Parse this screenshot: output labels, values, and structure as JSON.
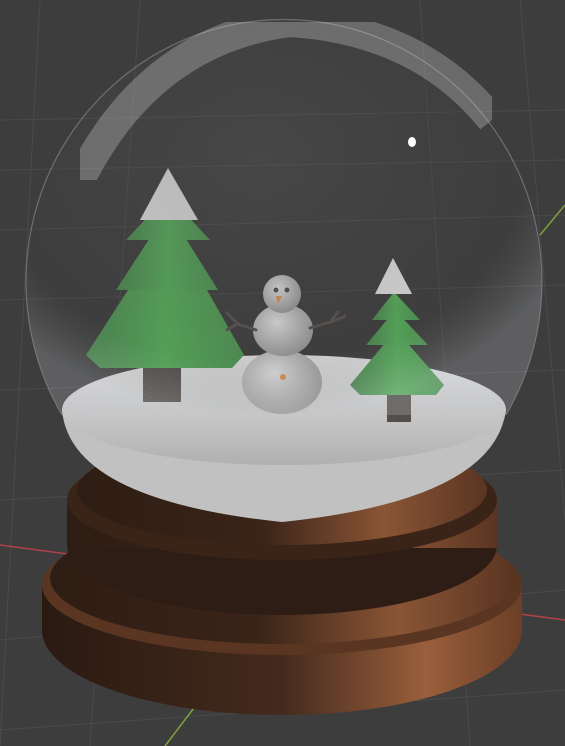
{
  "scene": {
    "background_color": "#3d3d3d",
    "grid_line_color": "#4a4a4a",
    "axis_x_color": "#b0414a",
    "axis_y_color": "#7ea33a",
    "objects": {
      "globe": {
        "glass_color": "#bfc3c8"
      },
      "snow_floor": {
        "color": "#d9d9d9"
      },
      "base": {
        "color": "#6b3f26",
        "highlight": "#9a5f3c",
        "shadow": "#2e1d14"
      },
      "tree_left": {
        "foliage": "#2f9a36",
        "trunk": "#2e2116",
        "snowcap": "#e2e2e2"
      },
      "tree_right": {
        "foliage": "#2f9a36",
        "trunk": "#2e2116",
        "snowcap": "#e2e2e2"
      },
      "snowman": {
        "body": "#cfcfcf",
        "nose": "#e08a2a",
        "eyes": "#222222",
        "arms": "#3a2a22",
        "button": "#e08a2a"
      }
    }
  }
}
